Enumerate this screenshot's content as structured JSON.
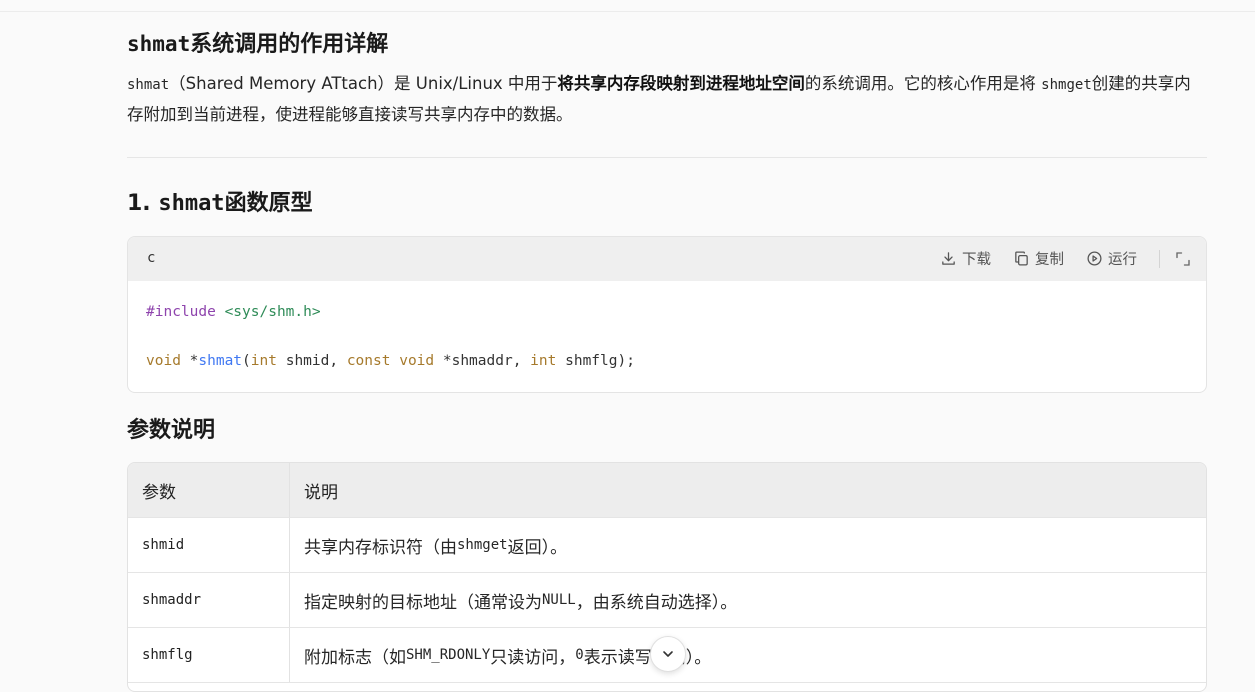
{
  "heading": {
    "code": "shmat",
    "text": "系统调用的作用详解"
  },
  "intro": {
    "code1": "shmat",
    "part1": "（Shared Memory ATtach）是 Unix/Linux 中用于",
    "bold": "将共享内存段映射到进程地址空间",
    "part2": "的系统调用。它的核心作用是将 ",
    "code2": "shmget",
    "part3": "创建的共享内存附加到当前进程，使进程能够直接读写共享内存中的数据。"
  },
  "section1": {
    "prefix": "1. ",
    "code": "shmat",
    "text": "函数原型"
  },
  "codeblock": {
    "lang": "c",
    "download_label": "下载",
    "copy_label": "复制",
    "run_label": "运行",
    "line1": {
      "directive": "#include",
      "header": "<sys/shm.h>"
    },
    "line2": {
      "t1": "void",
      "t2": " *",
      "fn": "shmat",
      "t3": "(",
      "t4": "int",
      "t5": " shmid, ",
      "t6": "const",
      "t7": " ",
      "t8": "void",
      "t9": " *shmaddr, ",
      "t10": "int",
      "t11": " shmflg);"
    }
  },
  "params_heading": "参数说明",
  "table": {
    "headers": [
      "参数",
      "说明"
    ],
    "rows": [
      {
        "param": "shmid",
        "d1": "共享内存标识符（由 ",
        "dcode": "shmget",
        "d2": "返回）。"
      },
      {
        "param": "shmaddr",
        "d1": "指定映射的目标地址（通常设为 ",
        "dcode": "NULL",
        "d2": "，由系统自动选择）。"
      },
      {
        "param": "shmflg",
        "d1": "附加标志（如 ",
        "dcode": "SHM_RDONLY",
        "d2": "只读访问，",
        "dcode2": "0",
        "d3": "表示读写访问）。"
      }
    ]
  }
}
